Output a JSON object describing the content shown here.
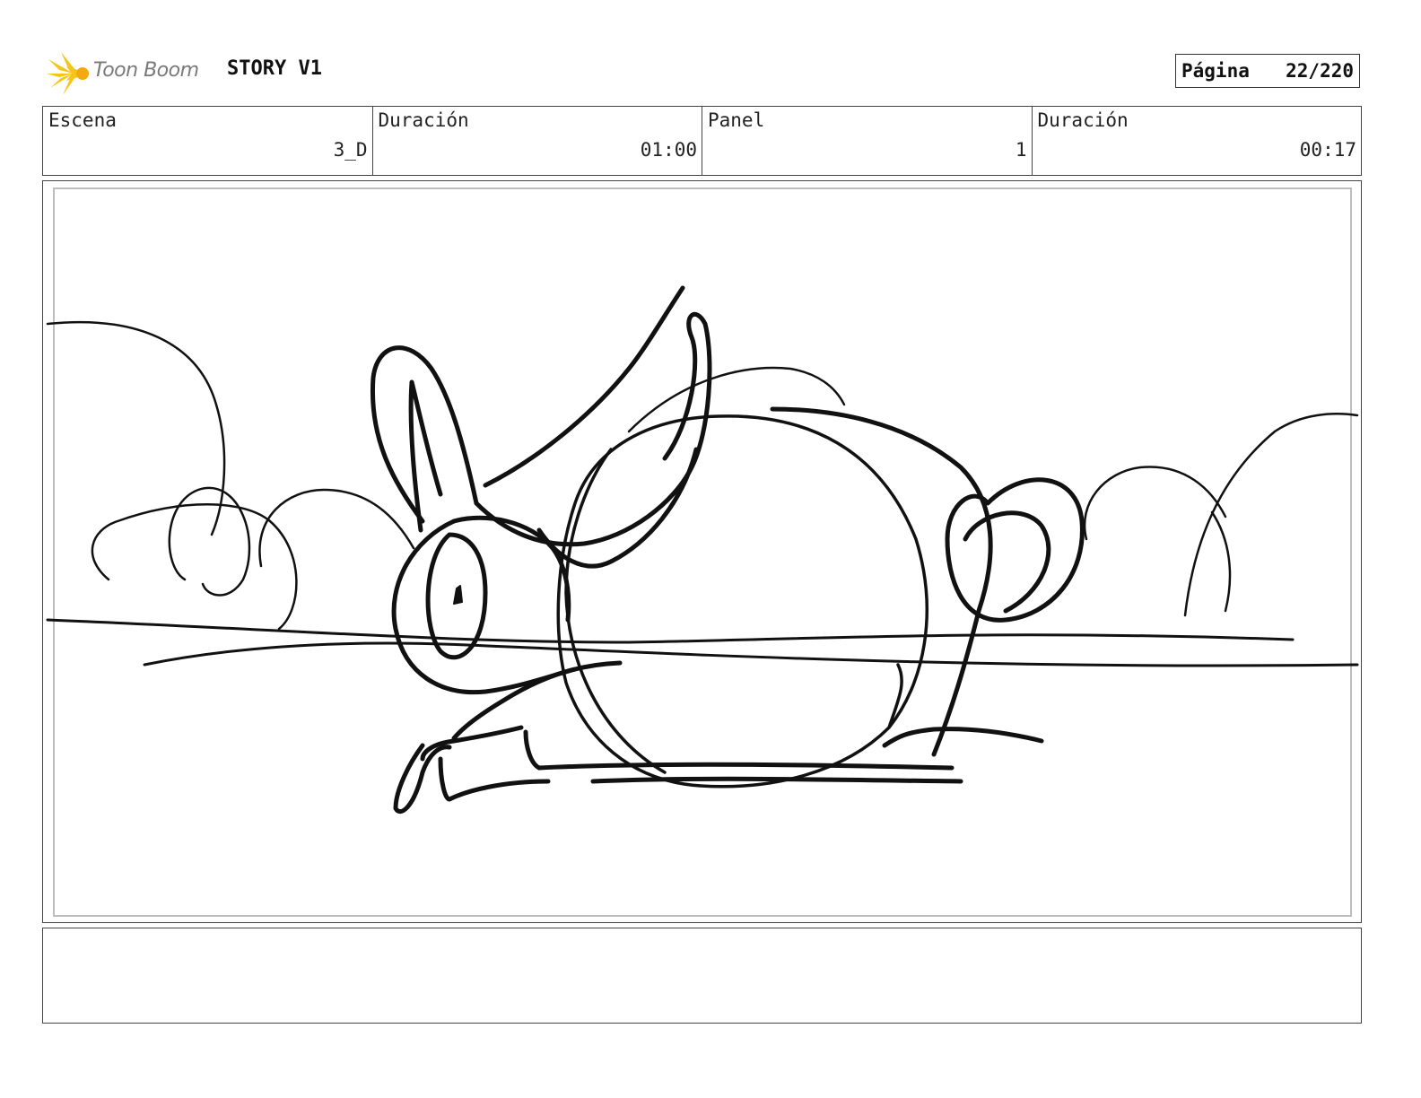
{
  "header": {
    "logo_text": "Toon Boom",
    "title": "STORY V1",
    "page_label": "Página",
    "page_value": "22/220"
  },
  "info": {
    "scene_label": "Escena",
    "scene_value": "3_D",
    "scene_duration_label": "Duración",
    "scene_duration_value": "01:00",
    "panel_label": "Panel",
    "panel_value": "1",
    "panel_duration_label": "Duración",
    "panel_duration_value": "00:17"
  },
  "panel": {
    "image_icon": "rabbit-sketch"
  },
  "notes": {
    "text": ""
  },
  "colors": {
    "logo_yellow": "#f5c518",
    "logo_text_gray": "#7a7a7a",
    "border": "#444444",
    "inner_border": "#bdbdbd"
  }
}
